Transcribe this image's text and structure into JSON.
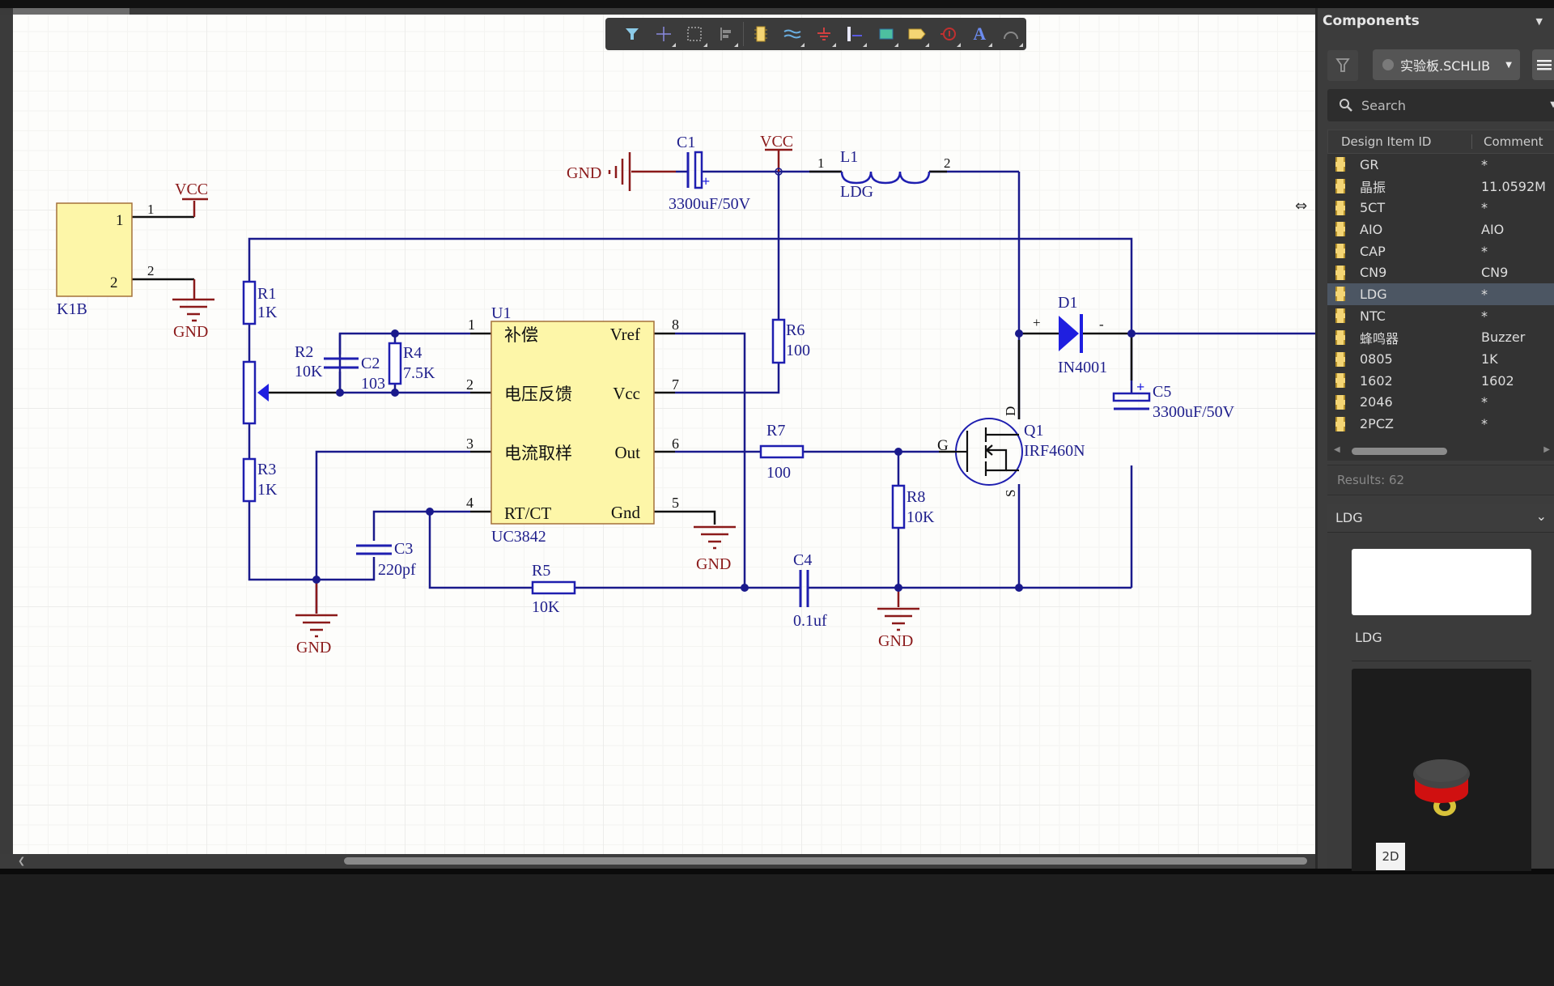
{
  "toolbar": {
    "buttons": [
      {
        "name": "filter",
        "label": "Filter"
      },
      {
        "name": "move",
        "label": "Move"
      },
      {
        "name": "select",
        "label": "Select"
      },
      {
        "name": "align",
        "label": "Align"
      },
      {
        "name": "place-part",
        "label": "Place Part"
      },
      {
        "name": "wire",
        "label": "Wire"
      },
      {
        "name": "power-port",
        "label": "Power Port"
      },
      {
        "name": "bus",
        "label": "Bus"
      },
      {
        "name": "sheet-symbol",
        "label": "Sheet Symbol"
      },
      {
        "name": "port",
        "label": "Port"
      },
      {
        "name": "no-erc",
        "label": "No ERC"
      },
      {
        "name": "text",
        "label": "Text"
      },
      {
        "name": "arc",
        "label": "Arc"
      }
    ]
  },
  "schematic": {
    "net_labels": {
      "vcc": "VCC",
      "gnd": "GND"
    },
    "k1b": {
      "ref": "K1B",
      "pin1": "1",
      "pin2": "2",
      "wire_pin1": "1",
      "wire_pin2": "2"
    },
    "r1": {
      "ref": "R1",
      "value": "1K"
    },
    "r2": {
      "ref": "R2",
      "value": "10K"
    },
    "r3": {
      "ref": "R3",
      "value": "1K"
    },
    "r4": {
      "ref": "R4",
      "value": "7.5K"
    },
    "r5": {
      "ref": "R5",
      "value": "10K"
    },
    "r6": {
      "ref": "R6",
      "value": "100"
    },
    "r7": {
      "ref": "R7",
      "value": "100"
    },
    "r8": {
      "ref": "R8",
      "value": "10K"
    },
    "c1": {
      "ref": "C1",
      "value": "3300uF/50V",
      "polarity": "+"
    },
    "c2": {
      "ref": "C2",
      "value": "103"
    },
    "c3": {
      "ref": "C3",
      "value": "220pf"
    },
    "c4": {
      "ref": "C4",
      "value": "0.1uf"
    },
    "c5": {
      "ref": "C5",
      "value": "3300uF/50V",
      "polarity": "+"
    },
    "l1": {
      "ref": "L1",
      "value": "LDG",
      "pin1": "1",
      "pin2": "2"
    },
    "d1": {
      "ref": "D1",
      "value": "IN4001",
      "anode": "+",
      "cathode": "-"
    },
    "q1": {
      "ref": "Q1",
      "value": "IRF460N",
      "gate": "G",
      "drain": "D",
      "source": "S"
    },
    "u1": {
      "ref": "U1",
      "value": "UC3842",
      "left_pins": [
        {
          "num": "1",
          "name": "补偿"
        },
        {
          "num": "2",
          "name": "电压反馈"
        },
        {
          "num": "3",
          "name": "电流取样"
        },
        {
          "num": "4",
          "name": "RT/CT"
        }
      ],
      "right_pins": [
        {
          "num": "8",
          "name": "Vref"
        },
        {
          "num": "7",
          "name": "Vcc"
        },
        {
          "num": "6",
          "name": "Out"
        },
        {
          "num": "5",
          "name": "Gnd"
        }
      ]
    }
  },
  "panel": {
    "title": "Components",
    "library": "实验板.SCHLIB",
    "search_placeholder": "Search",
    "columns": [
      "Design Item ID",
      "Comment"
    ],
    "items": [
      {
        "id": "GR",
        "comment": "*"
      },
      {
        "id": "晶振",
        "comment": "11.0592M"
      },
      {
        "id": "5CT",
        "comment": "*"
      },
      {
        "id": "AIO",
        "comment": "AIO"
      },
      {
        "id": "CAP",
        "comment": "*"
      },
      {
        "id": "CN9",
        "comment": "CN9"
      },
      {
        "id": "LDG",
        "comment": "*",
        "selected": true
      },
      {
        "id": "NTC",
        "comment": "*"
      },
      {
        "id": "蜂鸣器",
        "comment": "Buzzer"
      },
      {
        "id": "0805",
        "comment": "1K"
      },
      {
        "id": "1602",
        "comment": "1602"
      },
      {
        "id": "2046",
        "comment": "*"
      },
      {
        "id": "2PCZ",
        "comment": "*"
      }
    ],
    "results": "Results: 62",
    "detail_title": "LDG",
    "detail_name": "LDG",
    "view_toggle": "2D"
  },
  "colors": {
    "wire": "#1a1a8c",
    "pin_line": "#111111",
    "component_blue": "#1f1fb0",
    "power_red": "#8b1a1a",
    "ic_fill": "#fdf6a8",
    "ic_border": "#a4713a",
    "panel_bg": "#3c3c3c",
    "selected_row": "#4c5663"
  }
}
